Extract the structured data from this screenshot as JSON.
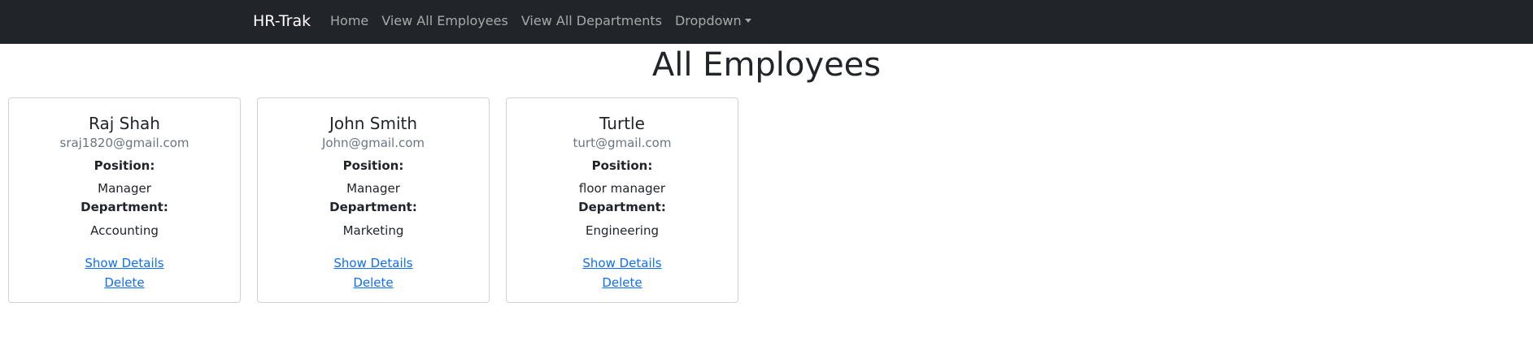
{
  "navbar": {
    "brand": "HR-Trak",
    "links": [
      "Home",
      "View All Employees",
      "View All Departments"
    ],
    "dropdown_label": "Dropdown"
  },
  "page_title": "All Employees",
  "labels": {
    "position": "Position:",
    "department": "Department:",
    "show_details": "Show Details",
    "delete": "Delete"
  },
  "employees": [
    {
      "name": "Raj Shah",
      "email": "sraj1820@gmail.com",
      "position": "Manager",
      "department": "Accounting"
    },
    {
      "name": "John Smith",
      "email": "John@gmail.com",
      "position": "Manager",
      "department": "Marketing"
    },
    {
      "name": "Turtle",
      "email": "turt@gmail.com",
      "position": "floor manager",
      "department": "Engineering"
    }
  ]
}
